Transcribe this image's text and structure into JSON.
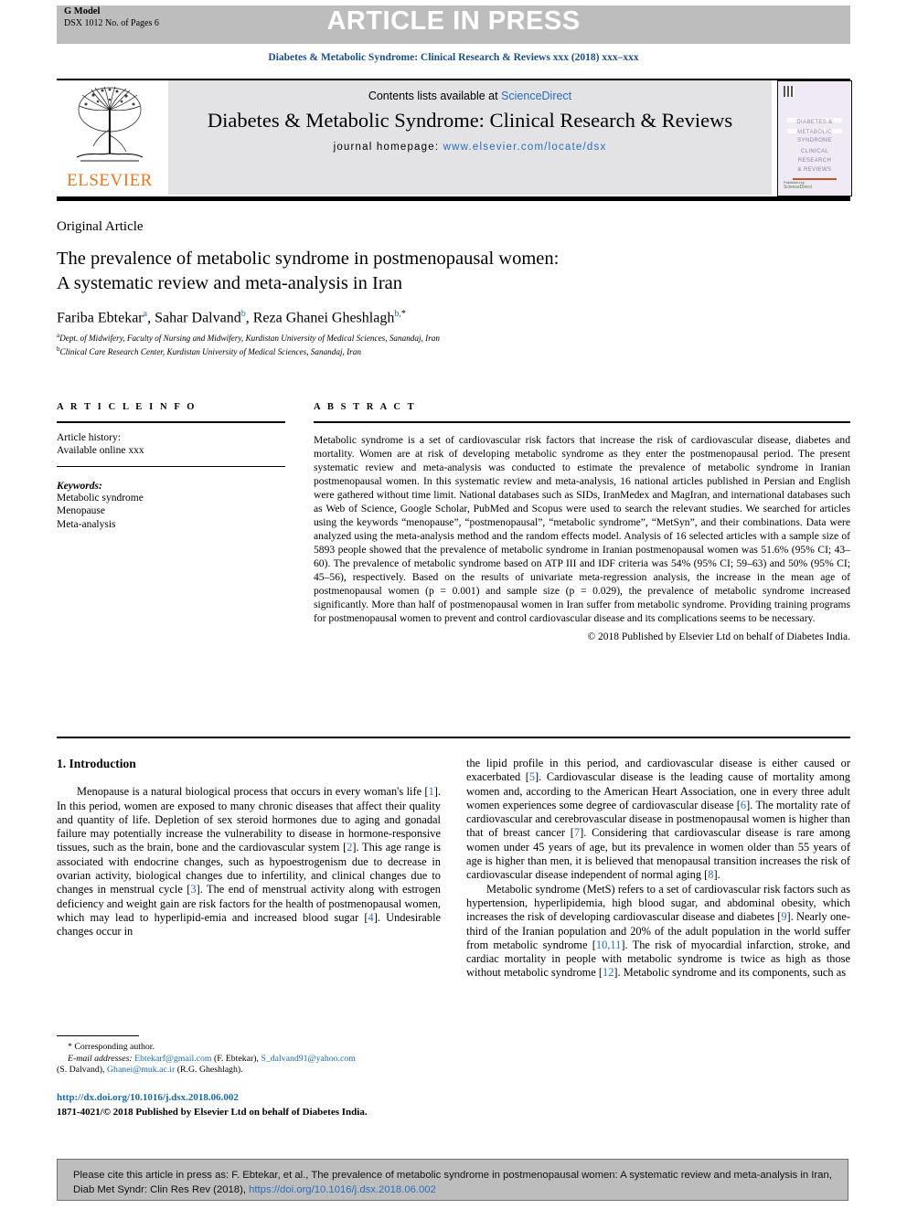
{
  "banner": {
    "g_model": "G Model",
    "article_id": "DSX 1012 No. of Pages 6",
    "status": "ARTICLE IN PRESS"
  },
  "running_head": "Diabetes & Metabolic Syndrome: Clinical Research & Reviews xxx (2018) xxx–xxx",
  "masthead": {
    "publisher": "ELSEVIER",
    "contents_prefix": "Contents lists available at ",
    "contents_link": "ScienceDirect",
    "journal_name": "Diabetes & Metabolic Syndrome: Clinical Research & Reviews",
    "homepage_label": "journal homepage: ",
    "homepage_url": "www.elsevier.com/locate/dsx",
    "cover": {
      "line1": "DIABETES &",
      "line2": "METABOLIC",
      "line3": "SYNDROME",
      "line4": "CLINICAL",
      "line5": "RESEARCH",
      "line6": "& REVIEWS",
      "sciencedirect": "ScienceDirect",
      "published_by": "Published by"
    }
  },
  "article": {
    "type_label": "Original Article",
    "title_line1": "The prevalence of metabolic syndrome in postmenopausal women:",
    "title_line2": "A systematic review and meta-analysis in Iran",
    "authors": [
      {
        "name": "Fariba Ebtekar",
        "sup": "a",
        "sep": ", "
      },
      {
        "name": "Sahar Dalvand",
        "sup": "b",
        "sep": ", "
      },
      {
        "name": "Reza Ghanei Gheshlagh",
        "sup": "b,",
        "star": "*",
        "sep": ""
      }
    ],
    "affiliations": [
      {
        "marker": "a",
        "text": "Dept. of Midwifery, Faculty of Nursing and Midwifery, Kurdistan University of Medical Sciences, Sanandaj, Iran"
      },
      {
        "marker": "b",
        "text": "Clinical Care Research Center, Kurdistan University of Medical Sciences, Sanandaj, Iran"
      }
    ]
  },
  "article_info": {
    "heading": "A R T I C L E   I N F O",
    "history_label": "Article history:",
    "history_value": "Available online xxx",
    "keywords_label": "Keywords:",
    "keywords": [
      "Metabolic syndrome",
      "Menopause",
      "Meta-analysis"
    ]
  },
  "abstract": {
    "heading": "A B S T R A C T",
    "body": "Metabolic syndrome is a set of cardiovascular risk factors that increase the risk of cardiovascular disease, diabetes and mortality. Women are at risk of developing metabolic syndrome as they enter the postmenopausal period. The present systematic review and meta-analysis was conducted to estimate the prevalence of metabolic syndrome in Iranian postmenopausal women. In this systematic review and meta-analysis, 16 national articles published in Persian and English were gathered without time limit. National databases such as SIDs, IranMedex and MagIran, and international databases such as Web of Science, Google Scholar, PubMed and Scopus were used to search the relevant studies. We searched for articles using the keywords “menopause”, “postmenopausal”, “metabolic syndrome”, “MetSyn”, and their combinations. Data were analyzed using the meta-analysis method and the random effects model. Analysis of 16 selected articles with a sample size of 5893 people showed that the prevalence of metabolic syndrome in Iranian postmenopausal women was 51.6% (95% CI; 43–60). The prevalence of metabolic syndrome based on ATP III and IDF criteria was 54% (95% CI; 59–63) and 50% (95% CI; 45–56), respectively. Based on the results of univariate meta-regression analysis, the increase in the mean age of postmenopausal women (p = 0.001) and sample size (p = 0.029), the prevalence of metabolic syndrome increased significantly. More than half of postmenopausal women in Iran suffer from metabolic syndrome. Providing training programs for postmenopausal women to prevent and control cardiovascular disease and its complications seems to be necessary.",
    "copyright": "© 2018 Published by Elsevier Ltd on behalf of Diabetes India."
  },
  "introduction": {
    "heading": "1. Introduction",
    "left_paragraph": "Menopause is a natural biological process that occurs in every woman's life [1]. In this period, women are exposed to many chronic diseases that affect their quality and quantity of life. Depletion of sex steroid hormones due to aging and gonadal failure may potentially increase the vulnerability to disease in hormone-responsive tissues, such as the brain, bone and the cardiovascular system [2]. This age range is associated with endocrine changes, such as hypoestrogenism due to decrease in ovarian activity, biological changes due to infertility, and clinical changes due to changes in menstrual cycle [3]. The end of menstrual activity along with estrogen deficiency and weight gain are risk factors for the health of postmenopausal women, which may lead to hyperlipid-emia and increased blood sugar [4]. Undesirable changes occur in",
    "right_paragraph_1": "the lipid profile in this period, and cardiovascular disease is either caused or exacerbated [5]. Cardiovascular disease is the leading cause of mortality among women and, according to the American Heart Association, one in every three adult women experiences some degree of cardiovascular disease [6]. The mortality rate of cardiovascular and cerebrovascular disease in postmenopausal women is higher than that of breast cancer [7]. Considering that cardiovascular disease is rare among women under 45 years of age, but its prevalence in women older than 55 years of age is higher than men, it is believed that menopausal transition increases the risk of cardiovascular disease independent of normal aging [8].",
    "right_paragraph_2": "Metabolic syndrome (MetS) refers to a set of cardiovascular risk factors such as hypertension, hyperlipidemia, high blood sugar, and abdominal obesity, which increases the risk of developing cardiovascular disease and diabetes [9]. Nearly one-third of the Iranian population and 20% of the adult population in the world suffer from metabolic syndrome [10,11]. The risk of myocardial infarction, stroke, and cardiac mortality in people with metabolic syndrome is twice as high as those without metabolic syndrome [12]. Metabolic syndrome and its components, such as"
  },
  "footnotes": {
    "corresponding_marker": "*",
    "corresponding_label": "Corresponding author.",
    "email_label": "E-mail addresses:",
    "email_1": "Ebtekarf@gmail.com",
    "email_1_owner": "(F. Ebtekar),",
    "email_2": "S_dalvand91@yahoo.com",
    "email_2_owner": "(S. Dalvand),",
    "email_3": "Ghanei@muk.ac.ir",
    "email_3_owner": "(R.G. Gheshlagh).",
    "doi": "http://dx.doi.org/10.1016/j.dsx.2018.06.002",
    "issn": "1871-4021/© 2018 Published by Elsevier Ltd on behalf of Diabetes India."
  },
  "citation_box": {
    "text_part1": "Please cite this article in press as: F. Ebtekar, et al., The prevalence of metabolic syndrome in postmenopausal women: A systematic review and meta-analysis in Iran, Diab Met Syndr: Clin Res Rev (2018), ",
    "link": "https://doi.org/10.1016/j.dsx.2018.06.002"
  },
  "colors": {
    "banner_gray": "#bdbdbd",
    "link_blue": "#2a6ebb",
    "elsevier_orange": "#E87722",
    "masthead_gray": "#e3e3e5"
  }
}
